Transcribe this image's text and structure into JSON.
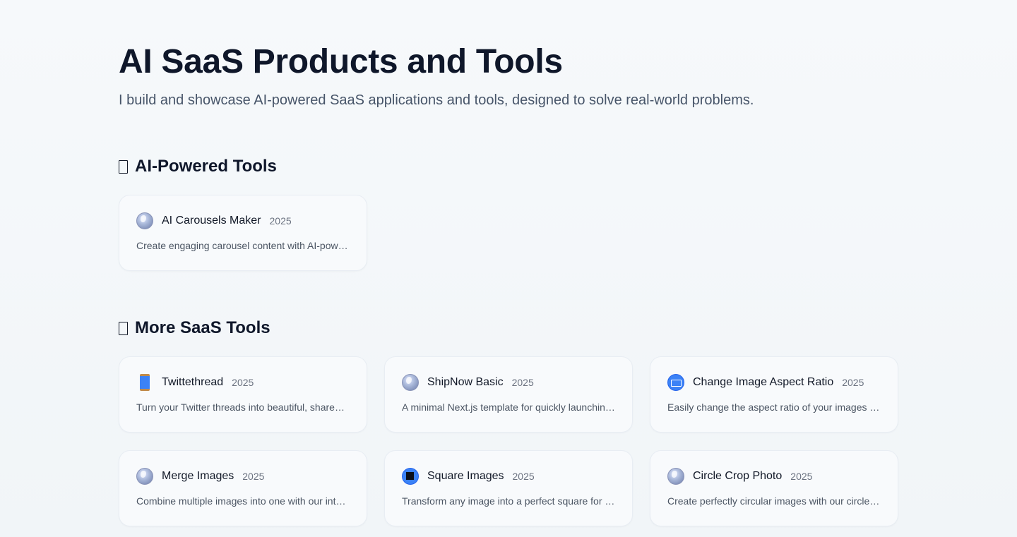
{
  "header": {
    "title": "AI SaaS Products and Tools",
    "subtitle": "I build and showcase AI-powered SaaS applications and tools, designed to solve real-world problems."
  },
  "sections": [
    {
      "heading": "AI-Powered Tools",
      "emoji_icon": "missing-glyph-box",
      "cards": [
        {
          "title": "AI Carousels Maker",
          "year": "2025",
          "icon": "globe-icon",
          "description": "Create engaging carousel content with AI-powered tools"
        }
      ]
    },
    {
      "heading": "More SaaS Tools",
      "emoji_icon": "missing-glyph-box",
      "cards": [
        {
          "title": "Twittethread",
          "year": "2025",
          "icon": "spool-icon",
          "description": "Turn your Twitter threads into beautiful, shareable images"
        },
        {
          "title": "ShipNow Basic",
          "year": "2025",
          "icon": "globe-icon",
          "description": "A minimal Next.js template for quickly launching your project"
        },
        {
          "title": "Change Image Aspect Ratio",
          "year": "2025",
          "icon": "film-icon",
          "description": "Easily change the aspect ratio of your images online"
        },
        {
          "title": "Merge Images",
          "year": "2025",
          "icon": "globe-icon",
          "description": "Combine multiple images into one with our intuitive tool"
        },
        {
          "title": "Square Images",
          "year": "2025",
          "icon": "square-icon",
          "description": "Transform any image into a perfect square for social media"
        },
        {
          "title": "Circle Crop Photo",
          "year": "2025",
          "icon": "globe-icon",
          "description": "Create perfectly circular images with our circle crop tool"
        }
      ]
    }
  ],
  "colors": {
    "background": "#f1f5f9",
    "card_background": "#f8fafc",
    "heading": "#0f172a",
    "subtitle": "#475569",
    "icon_blue": "#3b82f6"
  }
}
